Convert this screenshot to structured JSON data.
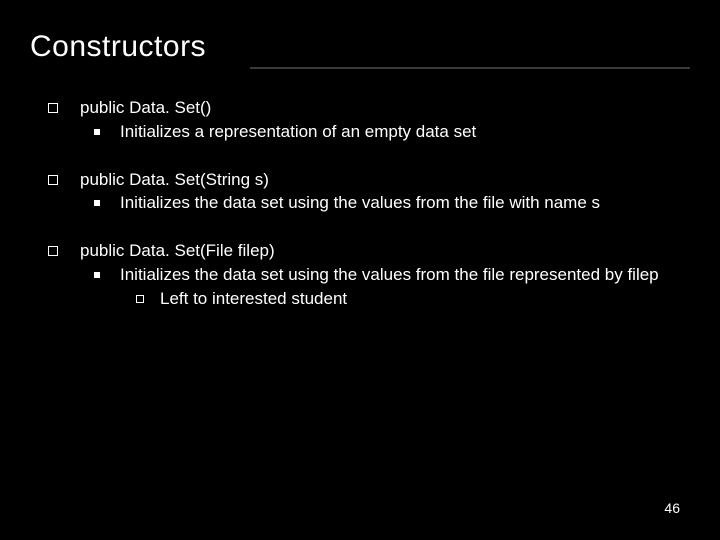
{
  "slide": {
    "title": "Constructors",
    "page_number": "46"
  },
  "bullets": {
    "b1": {
      "signature": "public Data. Set()",
      "desc": "Initializes a representation of an empty data set"
    },
    "b2": {
      "signature": "public Data. Set(String s)",
      "desc": "Initializes the data set using the values from the file with name s"
    },
    "b3": {
      "signature": "public Data. Set(File filep)",
      "desc": "Initializes the data set using the values from the file represented by filep",
      "sub": "Left to interested student"
    }
  }
}
